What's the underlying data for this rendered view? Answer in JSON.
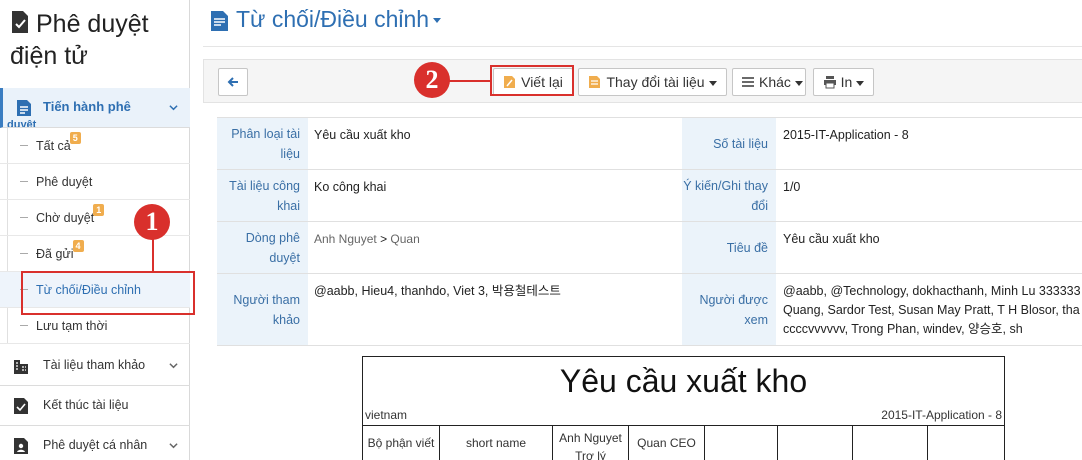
{
  "sidebar": {
    "app_title_line1": "Phê duyệt",
    "app_title_line2": "điện tử",
    "active_section": {
      "label": "Tiến hành phê",
      "label_cont": "duyệt"
    },
    "sub_items": [
      {
        "label": "Tất cả",
        "badge": "5"
      },
      {
        "label": "Phê duyệt",
        "badge": ""
      },
      {
        "label": "Chờ duyệt",
        "badge": "1"
      },
      {
        "label": "Đã gửi",
        "badge": "4"
      },
      {
        "label": "Từ chối/Điều chỉnh",
        "badge": ""
      },
      {
        "label": "Lưu tạm thời",
        "badge": ""
      }
    ],
    "sections": [
      {
        "label": "Tài liệu tham khảo"
      },
      {
        "label": "Kết thúc tài liệu"
      },
      {
        "label": "Phê duyệt cá nhân"
      }
    ]
  },
  "header": {
    "title": "Từ chối/Điều chỉnh"
  },
  "toolbar": {
    "rewrite": "Viết lại",
    "change_doc": "Thay đổi tài liệu",
    "other": "Khác",
    "print": "In"
  },
  "callouts": {
    "one": "1",
    "two": "2"
  },
  "info": {
    "doc_category_label": "Phân loại tài liệu",
    "doc_category_value": "Yêu cầu xuất kho",
    "doc_number_label": "Số tài liệu",
    "doc_number_value": "2015-IT-Application - 8",
    "public_label": "Tài liệu công khai",
    "public_value": "Ko công khai",
    "opinion_label": "Ý kiến/Ghi thay đổi",
    "opinion_value": "1/0",
    "flow_label": "Dòng phê duyệt",
    "flow_step1": "Anh Nguyet",
    "flow_sep": ">",
    "flow_step2": "Quan",
    "subject_label": "Tiêu đề",
    "subject_value": "Yêu cầu xuất kho",
    "ref_label": "Người tham khảo",
    "ref_value": "@aabb, Hieu4, thanhdo, Viet 3, 박용철테스트",
    "viewers_label": "Người được xem",
    "viewers_line1": "@aabb, @Technology, dokhacthanh, Minh Lu 333333",
    "viewers_line2": "Quang, Sardor Test, Susan May Pratt, T H Blosor, tha",
    "viewers_line3": "ccccvvvvvv, Trong Phan, windev, 양승호, sh"
  },
  "document": {
    "title": "Yêu cầu xuất kho",
    "left_text": "vietnam",
    "right_text": "2015-IT-Application - 8",
    "grid": [
      "Bộ phận viết",
      "short name",
      "Anh Nguyet",
      "Trợ lý",
      "Quan CEO"
    ]
  },
  "colors": {
    "accent": "#2e6fb2",
    "highlight": "#d9302c",
    "label_bg": "#ebf3fa",
    "badge": "#f0ad4e"
  }
}
